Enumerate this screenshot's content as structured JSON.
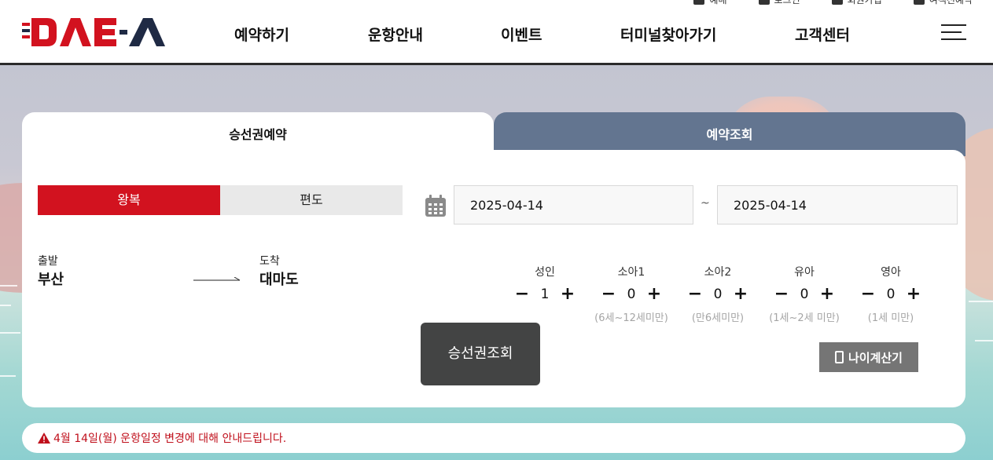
{
  "header": {
    "logo_text": "DAE-A",
    "utility": [
      "예매",
      "로그인",
      "회원가입",
      "여객선예약"
    ],
    "nav": [
      "예약하기",
      "운항안내",
      "이벤트",
      "터미널찾아가기",
      "고객센터"
    ]
  },
  "tabs": [
    {
      "label": "승선권예약",
      "active": true
    },
    {
      "label": "예약조회",
      "active": false
    }
  ],
  "trip_type": {
    "options": [
      "왕복",
      "편도"
    ],
    "selected": "왕복"
  },
  "dates": {
    "depart": "2025-04-14",
    "separator": "~",
    "return": "2025-04-14"
  },
  "route": {
    "from_label": "출발",
    "from_value": "부산",
    "to_label": "도착",
    "to_value": "대마도"
  },
  "passengers": [
    {
      "name": "성인",
      "count": "1",
      "sub": ""
    },
    {
      "name": "소아1",
      "count": "0",
      "sub": "(6세~12세미만)"
    },
    {
      "name": "소아2",
      "count": "0",
      "sub": "(만6세미만)"
    },
    {
      "name": "유아",
      "count": "0",
      "sub": "(1세~2세 미만)"
    },
    {
      "name": "영아",
      "count": "0",
      "sub": "(1세 미만)"
    }
  ],
  "controls": {
    "minus": "−",
    "plus": "+"
  },
  "search_button": "승선권조회",
  "age_calc_button": "나이계산기",
  "notice": "4월 14일(월) 운항일정 변경에 대해 안내드립니다.",
  "colors": {
    "brand_red": "#d2121f",
    "navy": "#1f2a44",
    "tab_inactive": "#637590",
    "dark_button": "#434444"
  }
}
